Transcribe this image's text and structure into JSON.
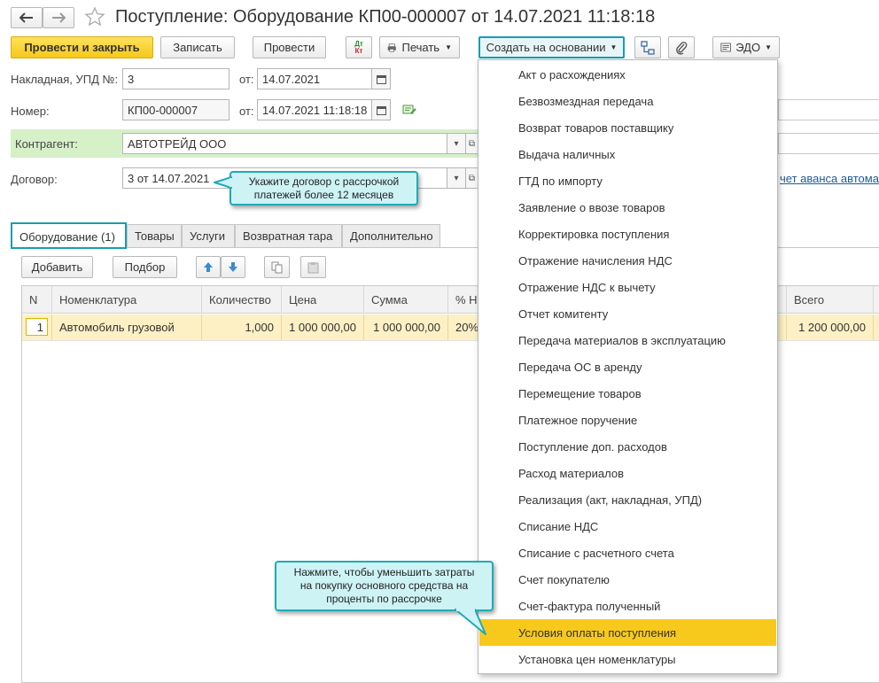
{
  "window": {
    "title": "Поступление: Оборудование КП00-000007 от 14.07.2021 11:18:18"
  },
  "toolbar": {
    "post_close": "Провести и закрыть",
    "save": "Записать",
    "post": "Провести",
    "dt_kt_top": "Дт",
    "dt_kt_bottom": "Кт",
    "print": "Печать",
    "create_based": "Создать на основании",
    "edo": "ЭДО"
  },
  "form": {
    "invoice_label": "Накладная, УПД №:",
    "invoice_value": "3",
    "from_label1": "от:",
    "invoice_date": "14.07.2021",
    "number_label": "Номер:",
    "number_value": "КП00-000007",
    "from_label2": "от:",
    "number_date": "14.07.2021 11:18:18",
    "contractor_label": "Контрагент:",
    "contractor_value": "АВТОТРЕЙД ООО",
    "contract_label": "Договор:",
    "contract_value": "3 от 14.07.2021",
    "advance_link": "чет аванса автома"
  },
  "tabs": [
    {
      "label": "Оборудование (1)"
    },
    {
      "label": "Товары"
    },
    {
      "label": "Услуги"
    },
    {
      "label": "Возвратная тара"
    },
    {
      "label": "Дополнительно"
    }
  ],
  "table_toolbar": {
    "add": "Добавить",
    "pick": "Подбор"
  },
  "table": {
    "headers": {
      "n": "N",
      "item": "Номенклатура",
      "qty": "Количество",
      "price": "Цена",
      "sum": "Сумма",
      "vat": "% Н",
      "total": "Всего"
    },
    "rows": [
      {
        "n": "1",
        "item": "Автомобиль грузовой",
        "qty": "1,000",
        "price": "1 000 000,00",
        "sum": "1 000 000,00",
        "vat": "20%",
        "total": "1 200 000,00"
      }
    ]
  },
  "menu": {
    "items": [
      "Акт о расхождениях",
      "Безвозмездная передача",
      "Возврат товаров поставщику",
      "Выдача наличных",
      "ГТД по импорту",
      "Заявление о ввозе товаров",
      "Корректировка поступления",
      "Отражение начисления НДС",
      "Отражение НДС к вычету",
      "Отчет комитенту",
      "Передача материалов в эксплуатацию",
      "Передача ОС в аренду",
      "Перемещение товаров",
      "Платежное поручение",
      "Поступление доп. расходов",
      "Расход материалов",
      "Реализация (акт, накладная, УПД)",
      "Списание НДС",
      "Списание с расчетного счета",
      "Счет покупателю",
      "Счет-фактура полученный",
      "Условия оплаты поступления",
      "Установка цен номенклатуры"
    ],
    "selected_index": 21
  },
  "callouts": {
    "contract_hint_line1": "Укажите договор с рассрочкой",
    "contract_hint_line2": "платежей более 12 месяцев",
    "menu_hint_line1": "Нажмите, чтобы уменьшить затраты",
    "menu_hint_line2": "на покупку основного средства на",
    "menu_hint_line3": "проценты по рассрочке"
  },
  "colors": {
    "accent": "#1a9bb2",
    "primary_button": "#f5c81b",
    "selected_row": "#fdf0c4",
    "menu_highlight": "#f8c91d",
    "contractor_row": "#d6f0c8",
    "callout_bg": "#cdf3f5"
  }
}
